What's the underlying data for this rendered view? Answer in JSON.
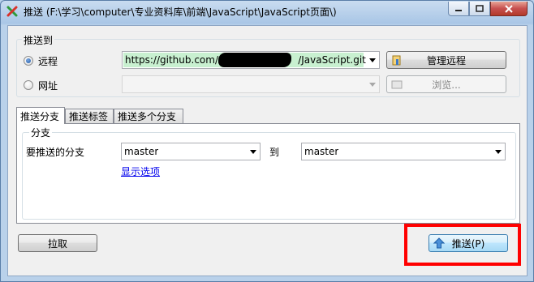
{
  "window": {
    "title": "推送 (F:\\学习\\computer\\专业资料库\\前端\\JavaScript\\JavaScript页面\\)"
  },
  "push_to": {
    "legend": "推送到",
    "remote_label": "远程",
    "remote_selected": true,
    "remote_url": "https://github.com/A█████████/JavaScript.git",
    "remote_url_prefix": "https://github.com/A",
    "remote_url_suffix": "/JavaScript.git",
    "manage_remote_label": "管理远程",
    "url_label": "网址",
    "url_value": "",
    "browse_label": "浏览..."
  },
  "tabs": [
    {
      "label": "推送分支",
      "active": true
    },
    {
      "label": "推送标签",
      "active": false
    },
    {
      "label": "推送多个分支",
      "active": false
    }
  ],
  "branch": {
    "legend": "分支",
    "local_label": "要推送的分支",
    "local_value": "master",
    "to_label": "到",
    "remote_value": "master",
    "show_options": "显示选项"
  },
  "buttons": {
    "pull_label": "拉取",
    "push_label": "推送(P)"
  },
  "icons": {
    "app": "tortoisegit-push-icon",
    "manage_remote": "remote-settings-icon",
    "browse": "folder-icon",
    "push": "up-arrow-icon"
  },
  "colors": {
    "highlight_url": "#c8f0d0",
    "annotation_border": "#ff0000"
  }
}
